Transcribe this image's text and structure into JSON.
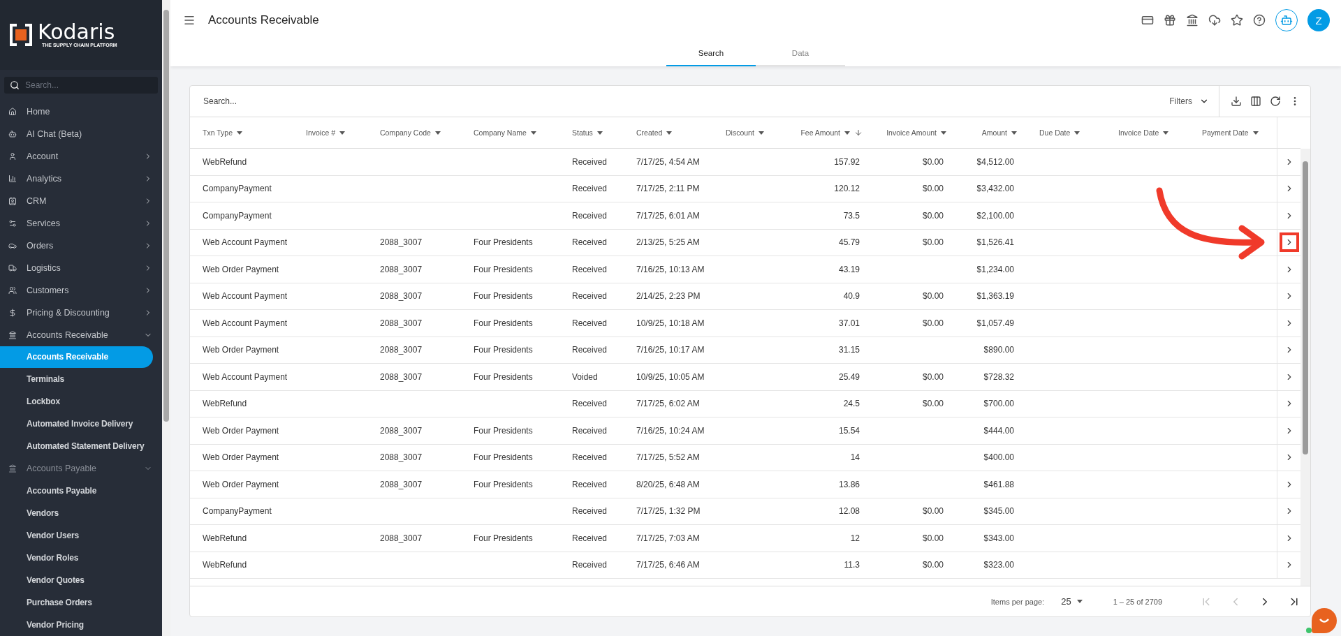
{
  "sidebar": {
    "logo": {
      "name": "Kodaris",
      "tagline": "THE SUPPLY CHAIN PLATFORM"
    },
    "search": {
      "placeholder": "Search..."
    },
    "items": [
      {
        "label": "Home",
        "kind": "link"
      },
      {
        "label": "AI Chat (Beta)",
        "kind": "link"
      },
      {
        "label": "Account",
        "kind": "group",
        "expanded": false
      },
      {
        "label": "Analytics",
        "kind": "group",
        "expanded": false
      },
      {
        "label": "CRM",
        "kind": "group",
        "expanded": false
      },
      {
        "label": "Services",
        "kind": "group",
        "expanded": false
      },
      {
        "label": "Orders",
        "kind": "group",
        "expanded": false
      },
      {
        "label": "Logistics",
        "kind": "group",
        "expanded": false
      },
      {
        "label": "Customers",
        "kind": "group",
        "expanded": false
      },
      {
        "label": "Pricing & Discounting",
        "kind": "group",
        "expanded": false
      },
      {
        "label": "Accounts Receivable",
        "kind": "group",
        "expanded": true,
        "children": [
          {
            "label": "Accounts Receivable",
            "selected": true
          },
          {
            "label": "Terminals",
            "selected": false
          },
          {
            "label": "Lockbox",
            "selected": false
          },
          {
            "label": "Automated Invoice Delivery",
            "selected": false
          },
          {
            "label": "Automated Statement Delivery",
            "selected": false
          }
        ]
      },
      {
        "label": "Accounts Payable",
        "kind": "group",
        "expanded": true,
        "children": [
          {
            "label": "Accounts Payable",
            "selected": false
          },
          {
            "label": "Vendors",
            "selected": false
          },
          {
            "label": "Vendor Users",
            "selected": false
          },
          {
            "label": "Vendor Roles",
            "selected": false
          },
          {
            "label": "Vendor Quotes",
            "selected": false
          },
          {
            "label": "Purchase Orders",
            "selected": false
          },
          {
            "label": "Vendor Pricing",
            "selected": false
          }
        ]
      }
    ]
  },
  "header": {
    "title": "Accounts Receivable",
    "avatar": "Z"
  },
  "tabs": [
    {
      "label": "Search",
      "selected": true
    },
    {
      "label": "Data",
      "selected": false
    }
  ],
  "toolbar": {
    "search_placeholder": "Search...",
    "filters": "Filters"
  },
  "table": {
    "columns": [
      {
        "label": "Txn Type",
        "sorted": false
      },
      {
        "label": "Invoice #",
        "sorted": false
      },
      {
        "label": "Company Code",
        "sorted": false
      },
      {
        "label": "Company Name",
        "sorted": false
      },
      {
        "label": "Status",
        "sorted": false
      },
      {
        "label": "Created",
        "sorted": false
      },
      {
        "label": "Discount",
        "sorted": false
      },
      {
        "label": "Fee Amount",
        "sorted": true
      },
      {
        "label": "Invoice Amount",
        "sorted": false
      },
      {
        "label": "Amount",
        "sorted": false
      },
      {
        "label": "Due Date",
        "sorted": false
      },
      {
        "label": "Invoice Date",
        "sorted": false
      },
      {
        "label": "Payment Date",
        "sorted": false
      }
    ],
    "rows": [
      {
        "txn_type": "WebRefund",
        "status": "Received",
        "created": "7/17/25, 4:54 AM",
        "fee_amount": "157.92",
        "invoice_amount": "$0.00",
        "amount": "$4,512.00",
        "highlighted": false
      },
      {
        "txn_type": "CompanyPayment",
        "status": "Received",
        "created": "7/17/25, 2:11 PM",
        "fee_amount": "120.12",
        "invoice_amount": "$0.00",
        "amount": "$3,432.00",
        "highlighted": false
      },
      {
        "txn_type": "CompanyPayment",
        "status": "Received",
        "created": "7/17/25, 6:01 AM",
        "fee_amount": "73.5",
        "invoice_amount": "$0.00",
        "amount": "$2,100.00",
        "highlighted": false
      },
      {
        "txn_type": "Web Account Payment",
        "company_code": "2088_3007",
        "company_name": "Four Presidents",
        "status": "Received",
        "created": "2/13/25, 5:25 AM",
        "fee_amount": "45.79",
        "invoice_amount": "$0.00",
        "amount": "$1,526.41",
        "highlighted": true
      },
      {
        "txn_type": "Web Order Payment",
        "company_code": "2088_3007",
        "company_name": "Four Presidents",
        "status": "Received",
        "created": "7/16/25, 10:13 AM",
        "fee_amount": "43.19",
        "amount": "$1,234.00",
        "highlighted": false
      },
      {
        "txn_type": "Web Account Payment",
        "company_code": "2088_3007",
        "company_name": "Four Presidents",
        "status": "Received",
        "created": "2/14/25, 2:23 PM",
        "fee_amount": "40.9",
        "invoice_amount": "$0.00",
        "amount": "$1,363.19",
        "highlighted": false
      },
      {
        "txn_type": "Web Account Payment",
        "company_code": "2088_3007",
        "company_name": "Four Presidents",
        "status": "Received",
        "created": "10/9/25, 10:18 AM",
        "fee_amount": "37.01",
        "invoice_amount": "$0.00",
        "amount": "$1,057.49",
        "highlighted": false
      },
      {
        "txn_type": "Web Order Payment",
        "company_code": "2088_3007",
        "company_name": "Four Presidents",
        "status": "Received",
        "created": "7/16/25, 10:17 AM",
        "fee_amount": "31.15",
        "amount": "$890.00",
        "highlighted": false
      },
      {
        "txn_type": "Web Account Payment",
        "company_code": "2088_3007",
        "company_name": "Four Presidents",
        "status": "Voided",
        "created": "10/9/25, 10:05 AM",
        "fee_amount": "25.49",
        "invoice_amount": "$0.00",
        "amount": "$728.32",
        "highlighted": false
      },
      {
        "txn_type": "WebRefund",
        "status": "Received",
        "created": "7/17/25, 6:02 AM",
        "fee_amount": "24.5",
        "invoice_amount": "$0.00",
        "amount": "$700.00",
        "highlighted": false
      },
      {
        "txn_type": "Web Order Payment",
        "company_code": "2088_3007",
        "company_name": "Four Presidents",
        "status": "Received",
        "created": "7/16/25, 10:24 AM",
        "fee_amount": "15.54",
        "amount": "$444.00",
        "highlighted": false
      },
      {
        "txn_type": "Web Order Payment",
        "company_code": "2088_3007",
        "company_name": "Four Presidents",
        "status": "Received",
        "created": "7/17/25, 5:52 AM",
        "fee_amount": "14",
        "amount": "$400.00",
        "highlighted": false
      },
      {
        "txn_type": "Web Order Payment",
        "company_code": "2088_3007",
        "company_name": "Four Presidents",
        "status": "Received",
        "created": "8/20/25, 6:48 AM",
        "fee_amount": "13.86",
        "amount": "$461.88",
        "highlighted": false
      },
      {
        "txn_type": "CompanyPayment",
        "status": "Received",
        "created": "7/17/25, 1:32 PM",
        "fee_amount": "12.08",
        "invoice_amount": "$0.00",
        "amount": "$345.00",
        "highlighted": false
      },
      {
        "txn_type": "WebRefund",
        "company_code": "2088_3007",
        "company_name": "Four Presidents",
        "status": "Received",
        "created": "7/17/25, 7:03 AM",
        "fee_amount": "12",
        "invoice_amount": "$0.00",
        "amount": "$343.00",
        "highlighted": false
      },
      {
        "txn_type": "WebRefund",
        "status": "Received",
        "created": "7/17/25, 6:46 AM",
        "fee_amount": "11.3",
        "invoice_amount": "$0.00",
        "amount": "$323.00",
        "highlighted": false
      }
    ]
  },
  "paginator": {
    "label": "Items per page:",
    "page_size": "25",
    "range": "1 – 25 of 2709",
    "first_disabled": true,
    "prev_disabled": true,
    "next_disabled": false,
    "last_disabled": false
  }
}
